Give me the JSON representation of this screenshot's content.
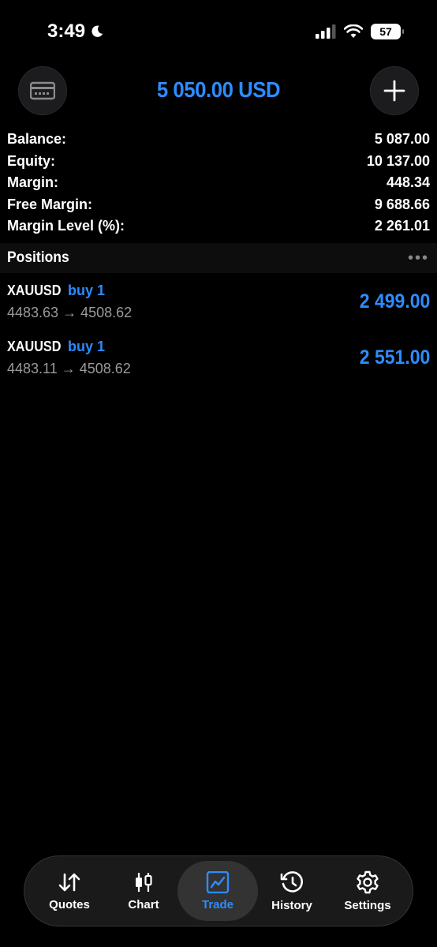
{
  "status_bar": {
    "time": "3:49",
    "battery": "57"
  },
  "header": {
    "title": "5 050.00 USD",
    "left_icon": "card-icon",
    "right_icon": "plus-icon"
  },
  "summary": [
    {
      "label": "Balance:",
      "value": "5 087.00"
    },
    {
      "label": "Equity:",
      "value": "10 137.00"
    },
    {
      "label": "Margin:",
      "value": "448.34"
    },
    {
      "label": "Free Margin:",
      "value": "9 688.66"
    },
    {
      "label": "Margin Level (%):",
      "value": "2 261.01"
    }
  ],
  "positions_section": {
    "title": "Positions",
    "more": "•••"
  },
  "positions": [
    {
      "symbol": "XAUUSD",
      "side": "buy 1",
      "prices": "4483.63 → 4508.62",
      "profit": "2 499.00"
    },
    {
      "symbol": "XAUUSD",
      "side": "buy 1",
      "prices": "4483.11 → 4508.62",
      "profit": "2 551.00"
    }
  ],
  "tabs": [
    {
      "label": "Quotes",
      "icon": "quotes-arrows-icon"
    },
    {
      "label": "Chart",
      "icon": "candlestick-icon"
    },
    {
      "label": "Trade",
      "icon": "trade-chart-icon",
      "active": true
    },
    {
      "label": "History",
      "icon": "history-clock-icon"
    },
    {
      "label": "Settings",
      "icon": "gear-icon"
    }
  ],
  "colors": {
    "accent": "#2d8cff",
    "background": "#000000",
    "muted": "#9a9a9a"
  }
}
